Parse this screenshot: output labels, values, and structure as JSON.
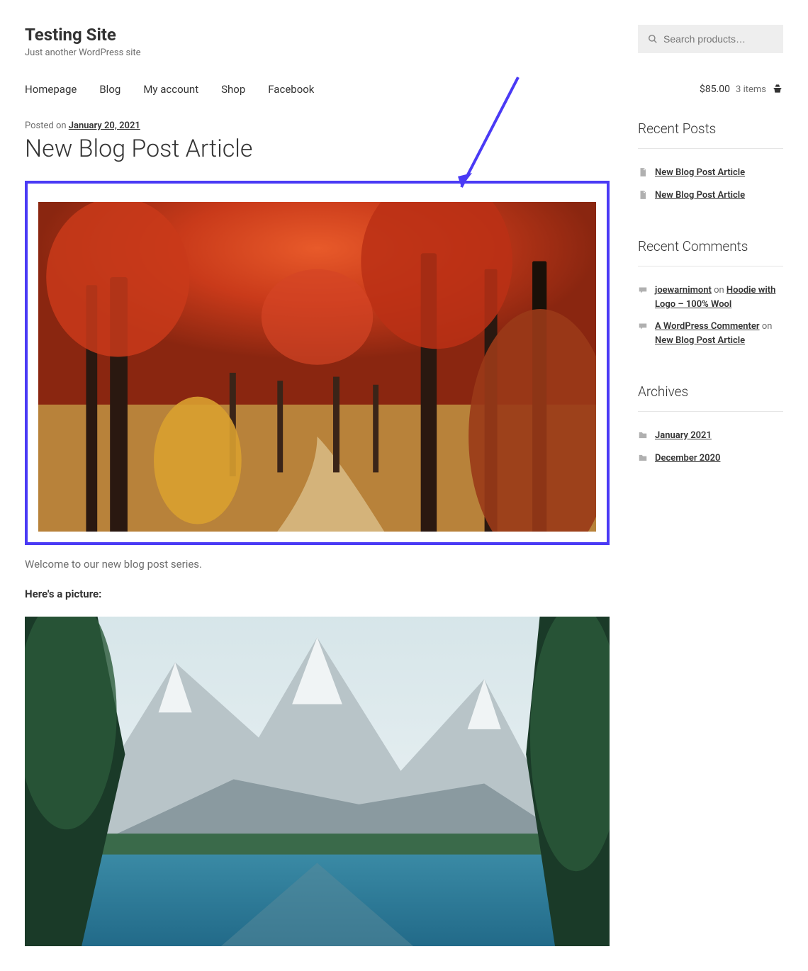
{
  "site": {
    "title": "Testing Site",
    "tagline": "Just another WordPress site"
  },
  "search": {
    "placeholder": "Search products…"
  },
  "nav": {
    "items": [
      {
        "label": "Homepage"
      },
      {
        "label": "Blog"
      },
      {
        "label": "My account"
      },
      {
        "label": "Shop"
      },
      {
        "label": "Facebook"
      }
    ]
  },
  "cart": {
    "price": "$85.00",
    "items": "3 items"
  },
  "post": {
    "posted_on_prefix": "Posted on ",
    "date": "January 20, 2021",
    "title": "New Blog Post Article",
    "welcome": "Welcome to our new blog post series.",
    "pic_label": "Here's a picture:"
  },
  "sidebar": {
    "recent_posts": {
      "title": "Recent Posts",
      "items": [
        {
          "label": "New Blog Post Article"
        },
        {
          "label": "New Blog Post Article"
        }
      ]
    },
    "recent_comments": {
      "title": "Recent Comments",
      "items": [
        {
          "author": "joewarnimont",
          "on": " on ",
          "target": "Hoodie with Logo – 100% Wool"
        },
        {
          "author": "A WordPress Commenter",
          "on": " on ",
          "target": "New Blog Post Article"
        }
      ]
    },
    "archives": {
      "title": "Archives",
      "items": [
        {
          "label": "January 2021"
        },
        {
          "label": "December 2020"
        }
      ]
    }
  }
}
